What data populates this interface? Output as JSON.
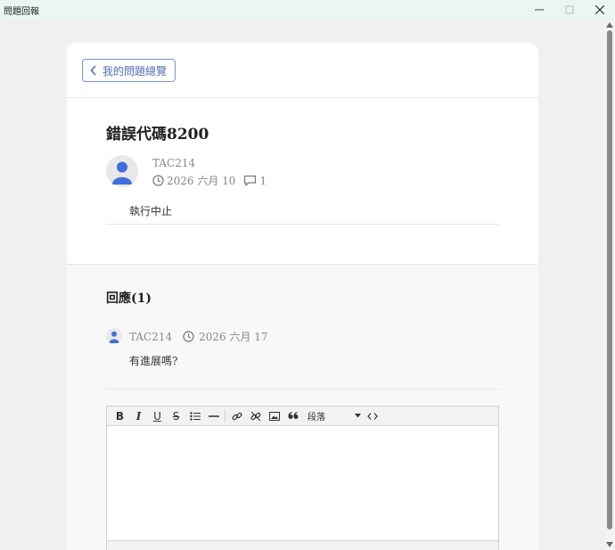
{
  "window": {
    "title": "問題回報"
  },
  "header": {
    "back_label": "我的問題總覽"
  },
  "post": {
    "title": "錯誤代碼8200",
    "author": "TAC214",
    "date": "2026 六月 10",
    "comment_count": "1",
    "body": "執行中止"
  },
  "replies": {
    "heading": "回應(1)",
    "items": [
      {
        "author": "TAC214",
        "date": "2026 六月 17",
        "body": "有進展嗎?"
      }
    ]
  },
  "editor": {
    "format_select": "段落",
    "toolbar_icons": [
      "bold-icon",
      "italic-icon",
      "underline-icon",
      "strikethrough-icon",
      "bullet-list-icon",
      "horizontal-rule-icon",
      "link-icon",
      "unlink-icon",
      "image-icon",
      "quote-icon",
      "code-icon"
    ]
  },
  "colors": {
    "accent": "#4e6db5",
    "titlebar": "#e9f6f4"
  }
}
